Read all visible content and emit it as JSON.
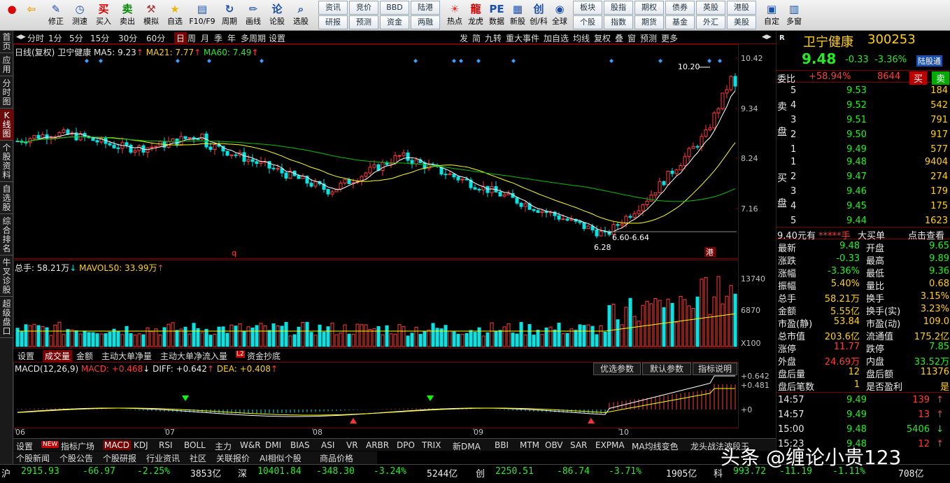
{
  "toolbar": {
    "items": [
      {
        "label": "",
        "icon": "red-circle-icon"
      },
      {
        "label": "",
        "icon": "back-arrow-icon"
      },
      {
        "label": "修正",
        "icon": "edit-icon"
      },
      {
        "label": "测速",
        "icon": "clock-icon"
      },
      {
        "label": "买入",
        "icon": "buy-icon",
        "glyph": "买"
      },
      {
        "label": "卖出",
        "icon": "sell-icon",
        "glyph": "卖"
      },
      {
        "label": "模拟",
        "icon": "gavel-icon"
      },
      {
        "label": "自选",
        "icon": "star-icon"
      },
      {
        "label": "F10/F9",
        "icon": "doc-icon"
      },
      {
        "label": "周期",
        "icon": "cycle-icon"
      },
      {
        "label": "画线",
        "icon": "pencil-icon"
      },
      {
        "label": "论股",
        "icon": "discuss-icon"
      },
      {
        "label": "选股",
        "icon": "search-chart-icon"
      }
    ],
    "grid_buttons": [
      [
        "资讯",
        "研报"
      ],
      [
        "竞价",
        "预测"
      ],
      [
        "BBD",
        "资金"
      ],
      [
        "陆港",
        "两融"
      ]
    ],
    "items2": [
      {
        "label": "热点",
        "icon": "hot-icon"
      },
      {
        "label": "龙虎",
        "icon": "dragon-icon"
      },
      {
        "label": "数据",
        "icon": "pe-icon",
        "glyph": "PE"
      },
      {
        "label": "新股",
        "icon": "newstock-icon"
      },
      {
        "label": "创/科",
        "icon": "chuang-icon",
        "glyph": "创"
      },
      {
        "label": "全球",
        "icon": "globe-icon"
      }
    ],
    "grid_buttons2": [
      [
        "板块",
        "个股"
      ],
      [
        "股指",
        "指数"
      ],
      [
        "期权",
        "期货"
      ],
      [
        "债券",
        "基金"
      ],
      [
        "英股",
        "外汇"
      ],
      [
        "港股",
        "美股"
      ]
    ],
    "items3": [
      {
        "label": "自定",
        "icon": "custom-icon"
      },
      {
        "label": "多窗",
        "icon": "multiwindow-icon"
      }
    ]
  },
  "left_sidebar": [
    "首页",
    "应用",
    "分时图",
    "K线图",
    "个股资料",
    "自选股",
    "综合排名",
    "牛叉诊股",
    "超级盘口"
  ],
  "period_bar": {
    "items": [
      "分时",
      "1分",
      "5分",
      "15分",
      "30分",
      "60分",
      "日",
      "周",
      "月",
      "季",
      "年",
      "多周期",
      "设置"
    ],
    "active": "日",
    "right": [
      "发",
      "简",
      "九转",
      "重大事件",
      "加自选",
      "均线",
      "复权",
      "叠",
      "窗",
      "预测",
      "更多"
    ]
  },
  "chart_info": {
    "mode": "日线(复权)",
    "name": "卫宁健康",
    "ma5": "MA5: 9.23",
    "ma21": "MA21: 7.77",
    "ma60": "MA60: 7.49"
  },
  "price_axis": [
    "10.42",
    "9.34",
    "8.24",
    "7.16"
  ],
  "annotations": {
    "high": "10.20",
    "low": "6.28",
    "range": "6.60-6.64",
    "q_marker": "q",
    "hk_badge": "港"
  },
  "volume_info": {
    "total": "总手: 58.21万",
    "mavol": "MAVOL50: 33.99万"
  },
  "volume_axis": [
    "13740",
    "6870",
    "X100"
  ],
  "sub_tabs": {
    "items": [
      "设置",
      "成交量",
      "金额",
      "主动大单净量",
      "主动大单净流入量",
      "资金抄底"
    ],
    "active": "成交量",
    "l2": "L2"
  },
  "macd_info": {
    "name": "MACD(12,26,9)",
    "macd": "MACD: +0.468",
    "diff": "DIFF: +0.642",
    "dea": "DEA: +0.408"
  },
  "macd_buttons": [
    "优选参数",
    "默认参数",
    "指标说明"
  ],
  "macd_axis": [
    "+0.642",
    "+0.481",
    "+0"
  ],
  "month_labels": [
    "06",
    "07",
    "08",
    "09",
    "10"
  ],
  "indicator_tabs": {
    "new_badge": "NEW",
    "items": [
      "设置",
      "指标广场",
      "MACD",
      "KDJ",
      "RSI",
      "BOLL",
      "主力",
      "W&R",
      "DMI",
      "BIAS",
      "ASI",
      "VR",
      "ARBR",
      "DPO",
      "TRIX",
      "新DMA",
      "BBI",
      "MTM",
      "OBV",
      "SAR",
      "EXPMA",
      "MA均线变色",
      "龙头战法波段王"
    ],
    "active": "MACD"
  },
  "news_tabs": [
    "个股新闻",
    "个股公告",
    "个股研报",
    "行业资讯",
    "社区",
    "关联报价",
    "AI相似个股",
    "商品价格"
  ],
  "right_panel": {
    "header": {
      "market": "R",
      "name": "卫宁健康",
      "code": "300253",
      "price": "9.48",
      "change": "-0.33",
      "pct": "-3.36%",
      "tag": "陆股通"
    },
    "weibi": {
      "label": "委比",
      "value": "+58.94%",
      "diff": "8644",
      "buy": "买",
      "sell": "卖"
    },
    "asks": [
      {
        "n": "5",
        "p": "9.53",
        "v": "184"
      },
      {
        "n": "4",
        "p": "9.52",
        "v": "542"
      },
      {
        "n": "3",
        "p": "9.51",
        "v": "791"
      },
      {
        "n": "2",
        "p": "9.50",
        "v": "917"
      },
      {
        "n": "1",
        "p": "9.49",
        "v": "577"
      }
    ],
    "bids": [
      {
        "n": "1",
        "p": "9.48",
        "v": "9404"
      },
      {
        "n": "2",
        "p": "9.47",
        "v": "274"
      },
      {
        "n": "3",
        "p": "9.46",
        "v": "179"
      },
      {
        "n": "4",
        "p": "9.45",
        "v": "175"
      },
      {
        "n": "5",
        "p": "9.44",
        "v": "1623"
      }
    ],
    "ask_label": [
      "卖",
      "盘"
    ],
    "bid_label": [
      "买",
      "盘"
    ],
    "big_order": {
      "price": "9.40元有",
      "stars": "*****手",
      "label": "大买单",
      "link": "点击查看"
    },
    "stats": [
      [
        "最新",
        "9.48",
        "开盘",
        "9.65"
      ],
      [
        "涨跌",
        "-0.33",
        "最高",
        "9.89"
      ],
      [
        "涨幅",
        "-3.36%",
        "最低",
        "9.36"
      ],
      [
        "振幅",
        "5.40%",
        "量比",
        "0.68"
      ],
      [
        "总手",
        "58.21万",
        "换手",
        "3.15%"
      ],
      [
        "金额",
        "5.55亿",
        "换手(实)",
        "3.23%"
      ],
      [
        "市盈(静)",
        "53.84",
        "市盈(动)",
        "109.0"
      ],
      [
        "总市值",
        "203.6亿",
        "流通值",
        "175.2亿"
      ],
      [
        "涨停",
        "11.77",
        "跌停",
        "7.85"
      ],
      [
        "外盘",
        "24.69万",
        "内盘",
        "33.52万"
      ],
      [
        "盘后量",
        "12",
        "盘后额",
        "11376"
      ],
      [
        "盘后笔数",
        "1",
        "是否盈利",
        "是"
      ]
    ],
    "ticks": [
      {
        "t": "14:57",
        "p": "9.49",
        "v": "139"
      },
      {
        "t": "14:57",
        "p": "9.49",
        "v": "13"
      },
      {
        "t": "15:00",
        "p": "9.48",
        "v": "5406"
      },
      {
        "t": "15:23",
        "p": "9.48",
        "v": "12"
      }
    ]
  },
  "status_bar": {
    "sh_label": "沪",
    "sh_val": "2915.93",
    "sh_chg": "-66.97",
    "sh_pct": "-2.25%",
    "sh_amt": "3853亿",
    "sz_label": "深",
    "sz_val": "10401.84",
    "sz_chg": "-348.30",
    "sz_pct": "-3.24%",
    "sz_amt": "5244亿",
    "cy_label": "创",
    "cy_val": "2250.51",
    "cy_chg": "-86.74",
    "cy_pct": "-3.71%",
    "cy_amt": "1905亿",
    "kc_label": "科",
    "kc_val": "993.72",
    "kc_chg": "-11.19",
    "kc_pct": "-1.11%",
    "kc_amt": "708亿"
  },
  "watermark": "头条 @缠论小贵123",
  "colors": {
    "up": "#ff3b3b",
    "down": "#00e5e5",
    "ma5": "#ffffff",
    "ma21": "#ffff00",
    "ma60": "#00c000",
    "border": "#7a0000"
  }
}
